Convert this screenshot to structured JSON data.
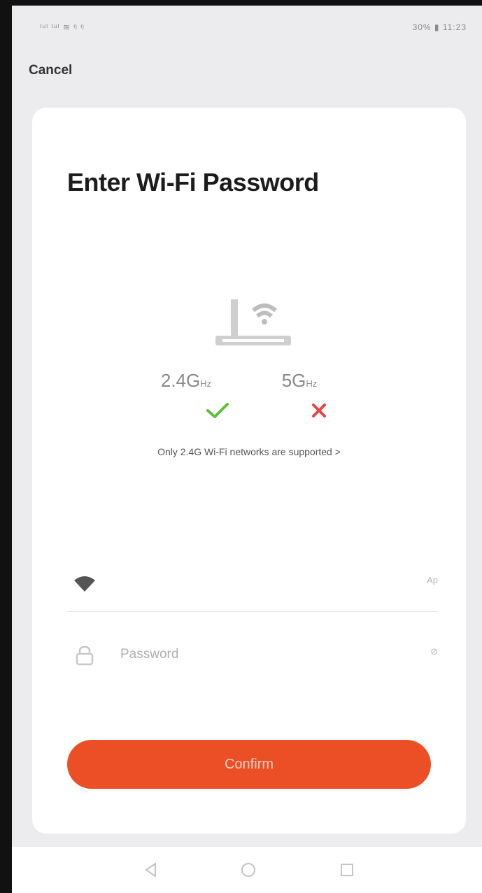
{
  "status_bar": {
    "left": "ᵗᵘˡ ᵗᵘˡ ≋ ᵑ ᵑ",
    "right": "30% ▮ 11:23"
  },
  "header": {
    "cancel_label": "Cancel"
  },
  "card": {
    "title": "Enter Wi-Fi Password",
    "bands": {
      "supported_value": "2.4G",
      "unsupported_value": "5G",
      "unit": "Hz",
      "supported_icon": "check-icon",
      "unsupported_icon": "cross-icon"
    },
    "support_note": "Only 2.4G Wi-Fi networks are supported >",
    "ssid_field": {
      "icon": "wifi-icon",
      "value": "",
      "action_label": "Ap"
    },
    "password_field": {
      "icon": "lock-icon",
      "placeholder": "Password",
      "value": "",
      "action_label": "⊘"
    },
    "confirm_label": "Confirm"
  },
  "nav_bar": {
    "back_icon": "back-triangle-icon",
    "home_icon": "home-circle-icon",
    "recents_icon": "recents-square-icon"
  },
  "colors": {
    "accent": "#ec4f25",
    "screen_background": "#ecebee",
    "success": "#5cbf3b",
    "error": "#e54545"
  }
}
